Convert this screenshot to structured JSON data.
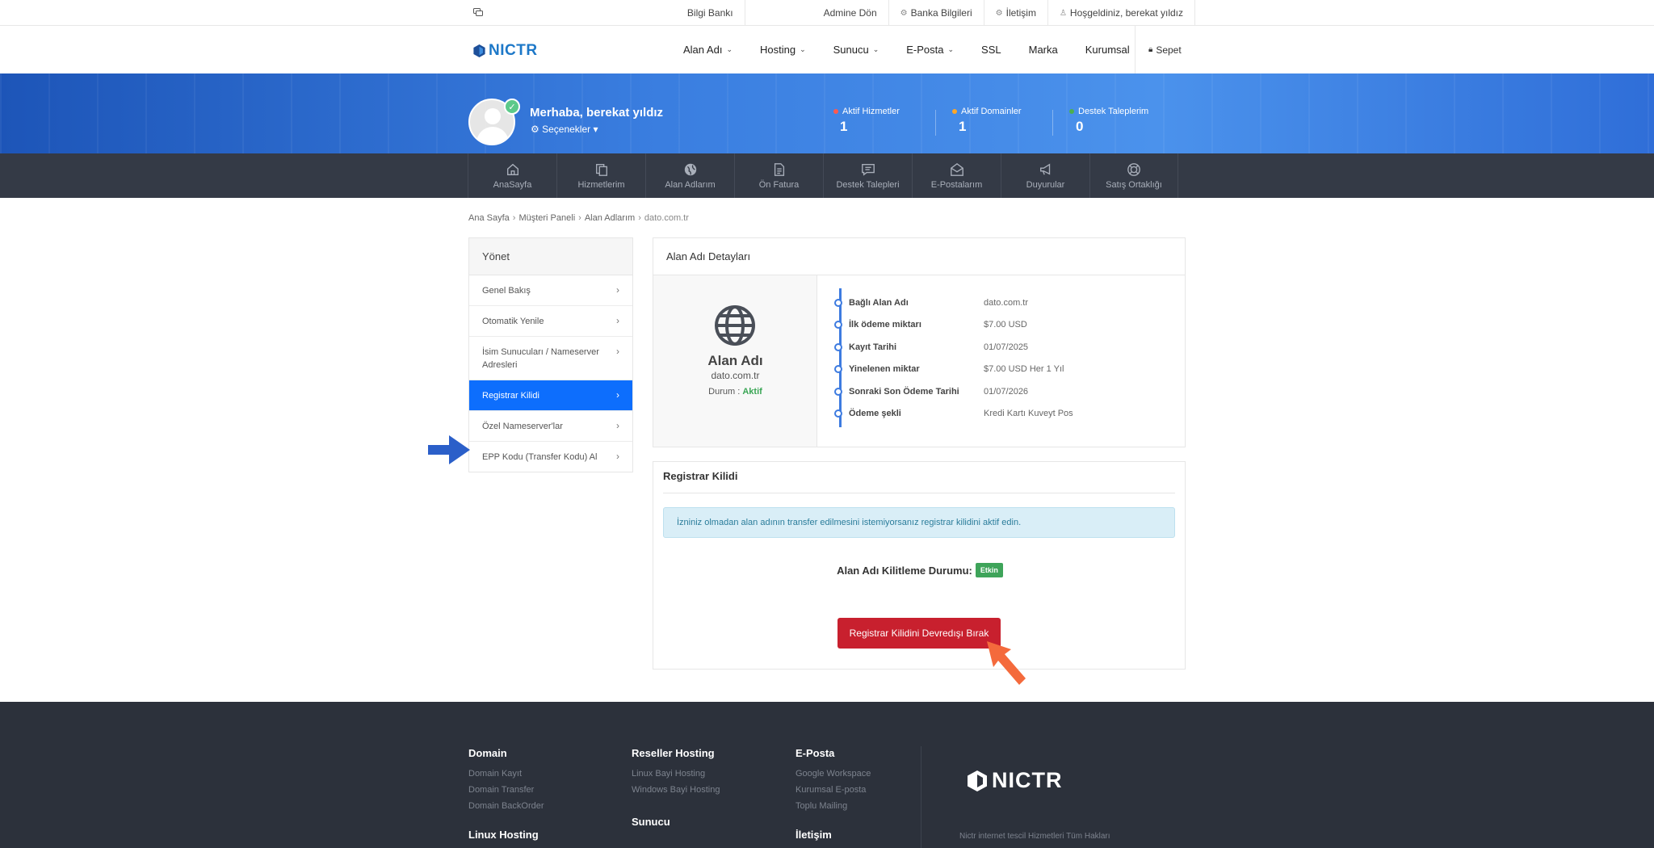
{
  "topbar": {
    "knowledge_base": "Bilgi Bankı",
    "admin_return": "Admine Dön",
    "bank_info": "Banka Bilgileri",
    "contact": "İletişim",
    "welcome": "Hoşgeldiniz, berekat yıldız"
  },
  "header": {
    "logo": "NICTR",
    "nav": [
      "Alan Adı",
      "Hosting",
      "Sunucu",
      "E-Posta",
      "SSL",
      "Marka",
      "Kurumsal"
    ],
    "cart": "Sepet"
  },
  "profile": {
    "greeting": "Merhaba, berekat yıldız",
    "options": "Seçenekler",
    "stats": [
      {
        "label": "Aktif Hizmetler",
        "value": "1",
        "color": "#ff5a4e"
      },
      {
        "label": "Aktif Domainler",
        "value": "1",
        "color": "#ffa726"
      },
      {
        "label": "Destek Taleplerim",
        "value": "0",
        "color": "#4caf50"
      }
    ]
  },
  "menu": [
    {
      "label": "AnaSayfa",
      "icon": "home-icon"
    },
    {
      "label": "Hizmetlerim",
      "icon": "copy-icon"
    },
    {
      "label": "Alan Adlarım",
      "icon": "globe-icon"
    },
    {
      "label": "Ön Fatura",
      "icon": "invoice-icon"
    },
    {
      "label": "Destek Talepleri",
      "icon": "chat-icon"
    },
    {
      "label": "E-Postalarım",
      "icon": "mail-icon"
    },
    {
      "label": "Duyurular",
      "icon": "megaphone-icon"
    },
    {
      "label": "Satış Ortaklığı",
      "icon": "lifebuoy-icon"
    }
  ],
  "breadcrumb": [
    "Ana Sayfa",
    "Müşteri Paneli",
    "Alan Adlarım",
    "dato.com.tr"
  ],
  "sidebar": {
    "title": "Yönet",
    "items": [
      "Genel Bakış",
      "Otomatik Yenile",
      "İsim Sunucuları / Nameserver Adresleri",
      "Registrar Kilidi",
      "Özel Nameserver'lar",
      "EPP Kodu (Transfer Kodu) Al"
    ],
    "active_index": 3
  },
  "details": {
    "title": "Alan Adı Detayları",
    "box_title": "Alan Adı",
    "domain": "dato.com.tr",
    "status_label": "Durum :",
    "status_value": "Aktif",
    "rows": [
      {
        "label": "Bağlı Alan Adı",
        "value": "dato.com.tr"
      },
      {
        "label": "İlk ödeme miktarı",
        "value": "$7.00 USD"
      },
      {
        "label": "Kayıt Tarihi",
        "value": "01/07/2025"
      },
      {
        "label": "Yinelenen miktar",
        "value": "$7.00 USD Her 1 Yıl"
      },
      {
        "label": "Sonraki Son Ödeme Tarihi",
        "value": "01/07/2026"
      },
      {
        "label": "Ödeme şekli",
        "value": "Kredi Kartı Kuveyt Pos"
      }
    ]
  },
  "registrar": {
    "title": "Registrar Kilidi",
    "info": "İzniniz olmadan alan adının transfer edilmesini istemiyorsanız registrar kilidini aktif edin.",
    "lock_label": "Alan Adı Kilitleme Durumu:",
    "lock_badge": "Etkin",
    "button": "Registrar Kilidini Devredışı Bırak"
  },
  "footer": {
    "columns": [
      {
        "title": "Domain",
        "links": [
          "Domain Kayıt",
          "Domain Transfer",
          "Domain BackOrder"
        ]
      },
      {
        "title": "Reseller Hosting",
        "links": [
          "Linux Bayi Hosting",
          "Windows Bayi Hosting"
        ]
      },
      {
        "title": "E-Posta",
        "links": [
          "Google Workspace",
          "Kurumsal E-posta",
          "Toplu Mailing"
        ]
      }
    ],
    "extra_titles": [
      "Linux Hosting",
      "Sunucu",
      "İletişim"
    ],
    "logo": "NICTR",
    "copyright": "Nictr internet tescil Hizmetleri Tüm Hakları"
  },
  "colors": {
    "primary": "#0d6efd",
    "danger": "#c8202e",
    "success": "#3ea45a",
    "dark": "#343a46"
  }
}
